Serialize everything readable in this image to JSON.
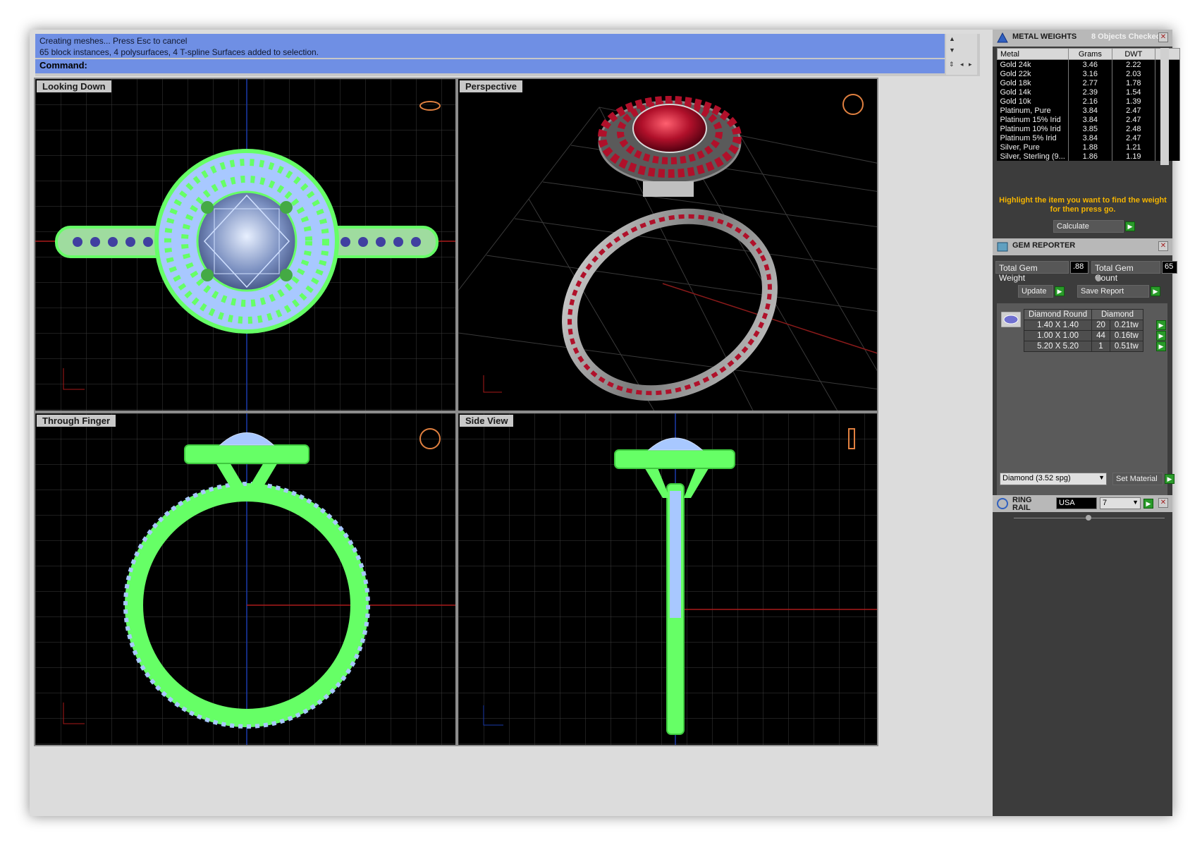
{
  "command": {
    "history": [
      "Creating meshes... Press Esc to cancel",
      "65 block instances, 4 polysurfaces, 4 T-spline Surfaces added to selection."
    ],
    "prompt_label": "Command:",
    "prompt_value": ""
  },
  "viewports": {
    "top_left": "Looking Down",
    "top_right": "Perspective",
    "bottom_left": "Through Finger",
    "bottom_right": "Side View"
  },
  "metal_weights": {
    "title": "METAL WEIGHTS",
    "status": "8 Objects Checked",
    "columns": [
      "Metal",
      "Grams",
      "DWT"
    ],
    "rows": [
      [
        "Gold 24k",
        "3.46",
        "2.22"
      ],
      [
        "Gold 22k",
        "3.16",
        "2.03"
      ],
      [
        "Gold 18k",
        "2.77",
        "1.78"
      ],
      [
        "Gold 14k",
        "2.39",
        "1.54"
      ],
      [
        "Gold 10k",
        "2.16",
        "1.39"
      ],
      [
        "Platinum, Pure",
        "3.84",
        "2.47"
      ],
      [
        "Platinum 15% Irid",
        "3.84",
        "2.47"
      ],
      [
        "Platinum 10% Irid",
        "3.85",
        "2.48"
      ],
      [
        "Platinum 5% Irid",
        "3.84",
        "2.47"
      ],
      [
        "Silver, Pure",
        "1.88",
        "1.21"
      ],
      [
        "Silver, Sterling (9...",
        "1.86",
        "1.19"
      ]
    ],
    "hint": "Highlight the item you want to find the weight for then press go.",
    "calculate_label": "Calculate"
  },
  "gem_reporter": {
    "title": "GEM REPORTER",
    "total_weight_label": "Total Gem Weight",
    "total_weight_value": ".88",
    "total_count_label": "Total Gem Count",
    "total_count_value": "65",
    "update_label": "Update",
    "save_report_label": "Save Report",
    "columns": [
      "Diamond Round",
      "Diamond"
    ],
    "rows": [
      [
        "1.40 X 1.40",
        "20",
        "0.21tw"
      ],
      [
        "1.00 X 1.00",
        "44",
        "0.16tw"
      ],
      [
        "5.20 X 5.20",
        "1",
        "0.51tw"
      ]
    ],
    "material_value": "Diamond     (3.52 spg)",
    "set_material_label": "Set Material"
  },
  "ring_rail": {
    "title": "RING RAIL",
    "country_value": "USA",
    "size_value": "7"
  },
  "colors": {
    "wire_green": "#66ff66",
    "wire_blue": "#a8c8ff",
    "ruby": "#b0102a",
    "metal": "#9a9a9a",
    "accent_yellow": "#f4b400"
  }
}
